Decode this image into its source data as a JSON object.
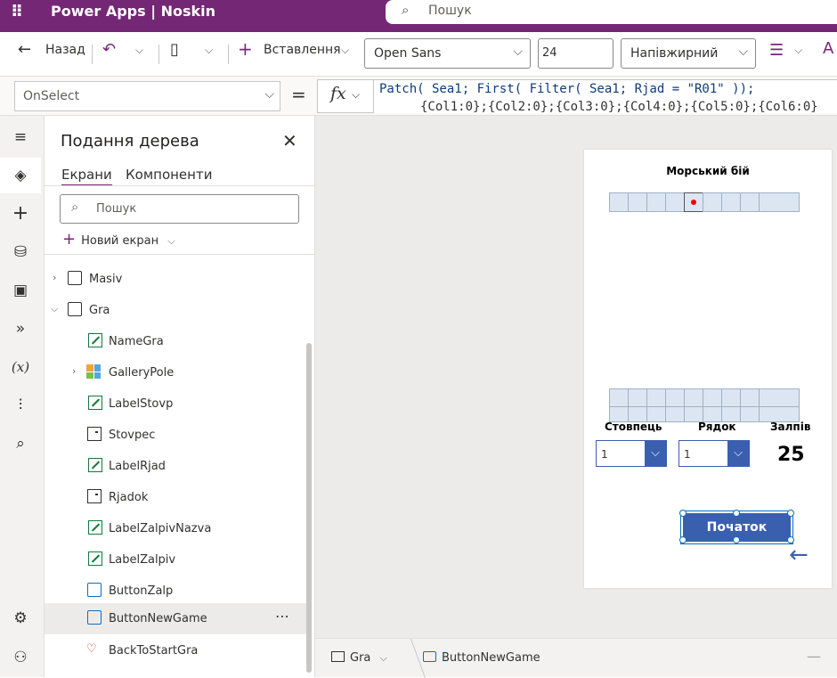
{
  "titlebar": {
    "app_name": "Power Apps  |  Noskin",
    "search_placeholder": "Пошук"
  },
  "command_bar": {
    "back_label": "Назад",
    "insert_label": "Вставлення",
    "font_family": "Open Sans",
    "font_size": "24",
    "font_weight": "Напівжирний"
  },
  "formula_bar": {
    "property": "OnSelect",
    "equals": "=",
    "fx": "fx",
    "formula_line1": "Patch( Sea1; First( Filter( Sea1; Rjad = \"R01\" ));",
    "formula_line2": "{Col1:0};{Col2:0};{Col3:0};{Col4:0};{Col5:0};{Col6:0}"
  },
  "tree": {
    "title": "Подання дерева",
    "tabs": [
      {
        "label": "Екрани"
      },
      {
        "label": "Компоненти"
      }
    ],
    "search_placeholder": "Пошук",
    "new_screen_label": "Новий екран",
    "items": [
      {
        "label": "Masiv",
        "icon": "screen-icon"
      },
      {
        "label": "Gra",
        "icon": "screen-icon"
      },
      {
        "label": "NameGra",
        "icon": "label-icon"
      },
      {
        "label": "GalleryPole",
        "icon": "gallery-icon"
      },
      {
        "label": "LabelStovp",
        "icon": "label-icon"
      },
      {
        "label": "Stovpec",
        "icon": "dropdown-icon"
      },
      {
        "label": "LabelRjad",
        "icon": "label-icon"
      },
      {
        "label": "Rjadok",
        "icon": "dropdown-icon"
      },
      {
        "label": "LabelZalpivNazva",
        "icon": "label-icon"
      },
      {
        "label": "LabelZalpiv",
        "icon": "label-icon"
      },
      {
        "label": "ButtonZalp",
        "icon": "button-icon"
      },
      {
        "label": "ButtonNewGame",
        "icon": "button-icon",
        "selected": true
      },
      {
        "label": "BackToStartGra",
        "icon": "icon-control-icon"
      }
    ]
  },
  "app_screen": {
    "title": "Морський бій",
    "label_column": "Стовпець",
    "label_row": "Рядок",
    "label_shots": "Залпів",
    "column_value": "1",
    "row_value": "1",
    "shots_value": "25",
    "new_game_button": "Початок",
    "accent_color": "#3a5fae",
    "hit_color": "#e00000"
  },
  "status_bar": {
    "screen": "Gra",
    "control": "ButtonNewGame"
  },
  "colors": {
    "brand": "#742774",
    "selection": "#0f6cbd"
  }
}
